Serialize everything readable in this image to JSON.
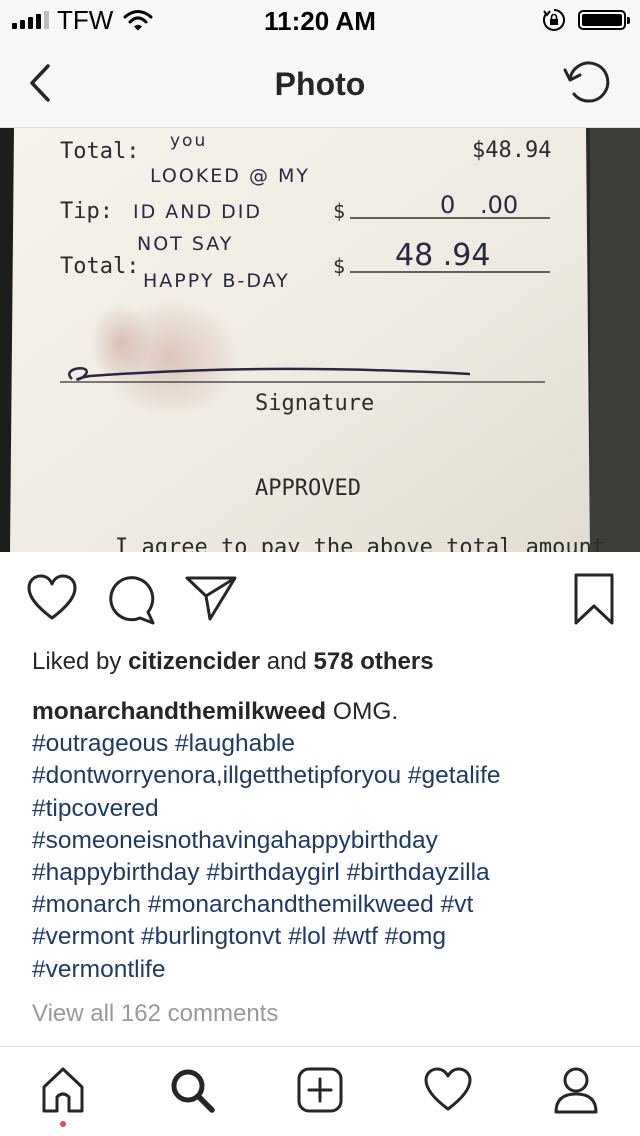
{
  "status_bar": {
    "carrier": "TFW",
    "time": "11:20 AM",
    "icons": [
      "signal-icon",
      "wifi-icon",
      "orientation-lock-icon",
      "battery-icon"
    ],
    "battery_level": 1.0
  },
  "nav": {
    "title": "Photo",
    "back_icon": "chevron-left-icon",
    "refresh_icon": "refresh-icon"
  },
  "photo": {
    "receipt": {
      "total_label_1": "Total:",
      "total_amount_1": "$48.94",
      "tip_label": "Tip:",
      "tip_dollar": "$",
      "tip_written_dollars": "0",
      "tip_written_cents": ".00",
      "total_label_2": "Total:",
      "total_dollar": "$",
      "total_written": "48 .94",
      "handwriting": [
        "you",
        "LOOKED @ MY",
        "ID AND DID",
        "NOT SAY",
        "HAPPY B-DAY"
      ],
      "signature_label": "Signature",
      "approved_label": "APPROVED",
      "agree_text": "I agree to pay the above total amount"
    }
  },
  "actions": {
    "like_icon": "heart-icon",
    "comment_icon": "comment-icon",
    "share_icon": "send-icon",
    "save_icon": "bookmark-icon"
  },
  "likes": {
    "prefix": "Liked by",
    "user": "citizencider",
    "middle": "and",
    "others": "578 others"
  },
  "caption": {
    "username": "monarchandthemilkweed",
    "text": "OMG.",
    "hashtags": [
      "#outrageous",
      "#laughable",
      "#dontworryenora,illgetthetipforyou",
      "#getalife",
      "#tipcovered",
      "#someoneisnothavingahappybirthday",
      "#happybirthday",
      "#birthdaygirl",
      "#birthdayzilla",
      "#monarch",
      "#monarchandthemilkweed",
      "#vt",
      "#vermont",
      "#burlingtonvt",
      "#lol",
      "#wtf",
      "#omg",
      "#vermontlife"
    ]
  },
  "view_comments": "View all 162 comments",
  "tab_bar": {
    "items": [
      {
        "name": "home",
        "icon": "home-icon",
        "active": true
      },
      {
        "name": "search",
        "icon": "search-icon"
      },
      {
        "name": "new-post",
        "icon": "add-post-icon"
      },
      {
        "name": "activity",
        "icon": "heart-icon"
      },
      {
        "name": "profile",
        "icon": "profile-icon"
      }
    ],
    "notification_color": "#ed4956"
  },
  "colors": {
    "hashtag": "#1f3a66",
    "muted": "#999999",
    "text": "#262626",
    "receipt_paper": "#f1eee6",
    "background": "#2a2b27"
  }
}
